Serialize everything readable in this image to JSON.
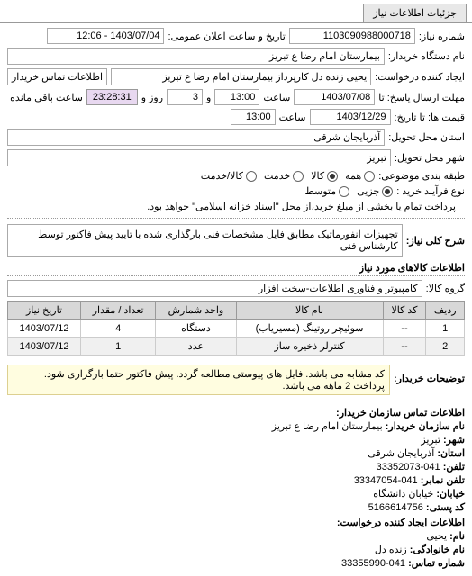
{
  "tab": {
    "label": "جزئیات اطلاعات نیاز"
  },
  "header": {
    "number_label": "شماره نیاز:",
    "number": "1103090988000718",
    "announce_label": "تاریخ و ساعت اعلان عمومی:",
    "announce": "1403/07/04 - 12:06",
    "buyer_org_label": "نام دستگاه خریدار:",
    "buyer_org": "بیمارستان امام رضا  ع  تبریز",
    "requester_label": "ایجاد کننده درخواست:",
    "requester": "یحیی  زنده دل کارپرداز بیمارستان امام رضا  ع  تبریز",
    "contact_btn": "اطلاعات تماس خریدار",
    "deadline_label": "مهلت ارسال پاسخ: تا",
    "deadline_date": "1403/07/08",
    "time_label": "ساعت",
    "deadline_time": "13:00",
    "and_label": "و",
    "days_remaining": "3",
    "remaining_label": "روز و",
    "remaining_time": "23:28:31",
    "remaining_suffix": "ساعت باقی مانده",
    "price_until_label": "قیمت ها: تا تاریخ:",
    "price_until_date": "1403/12/29",
    "price_until_time": "13:00",
    "province_label": "استان محل تحویل:",
    "province": "آذربایجان شرقی",
    "city_label": "شهر محل تحویل:",
    "city": "تبریز",
    "category_label": "طبقه بندی موضوعی:",
    "opt_all": "همه",
    "opt_goods": "کالا",
    "opt_service": "خدمت",
    "opt_goods_service": "کالا/خدمت",
    "buy_process_label": "نوع فرآیند خرید :",
    "opt_small": "جزیی",
    "opt_medium": "متوسط",
    "payment_note": "پرداخت تمام یا بخشی از مبلغ خرید،از محل \"اسناد خزانه اسلامی\" خواهد بود."
  },
  "need": {
    "title_label": "شرح کلی نیاز:",
    "title": "تجهیزات انفورماتیک مطابق فایل مشخصات فنی بارگذاری شده با تایید پیش فاکتور توسط کارشناس فنی",
    "goods_section": "اطلاعات کالاهای مورد نیاز",
    "group_label": "گروه کالا:",
    "group": "کامپیوتر و فناوری اطلاعات-سخت افزار"
  },
  "table": {
    "headers": [
      "ردیف",
      "کد کالا",
      "نام کالا",
      "واحد شمارش",
      "تعداد / مقدار",
      "تاریخ نیاز"
    ],
    "rows": [
      {
        "num": "1",
        "code": "--",
        "name": "سوئیچر روتینگ (مسیریاب)",
        "unit": "دستگاه",
        "qty": "4",
        "date": "1403/07/12"
      },
      {
        "num": "2",
        "code": "--",
        "name": "کنترلر ذخیره ساز",
        "unit": "عدد",
        "qty": "1",
        "date": "1403/07/12"
      }
    ]
  },
  "notes": {
    "buyer_note_label": "توضیحات خریدار:",
    "buyer_note": "کد مشابه می باشد. فایل های پیوستی مطالعه گردد. پیش فاکتور حتما بارگزاری شود. پرداخت 2 ماهه می باشد."
  },
  "contact": {
    "section": "اطلاعات تماس سازمان خریدار:",
    "org_label": "نام سازمان خریدار:",
    "org": "بیمارستان امام رضا ع تبریز",
    "city_label": "شهر:",
    "city": "تبریز",
    "province_label": "استان:",
    "province": "آذربایجان شرقی",
    "phone_label": "تلفن:",
    "phone": "041-33352073",
    "fax_label": "تلفن نمابر:",
    "fax": "041-33347054",
    "street_label": "خیابان:",
    "street": "خیابان دانشگاه",
    "postal_label": "کد پستی:",
    "postal": "5166614756",
    "creator_section": "اطلاعات ایجاد کننده درخواست:",
    "name_label": "نام:",
    "name": "یحیی",
    "lname_label": "نام خانوادگی:",
    "lname": "زنده دل",
    "cphone_label": "شماره تماس:",
    "cphone": "041-33355990"
  }
}
